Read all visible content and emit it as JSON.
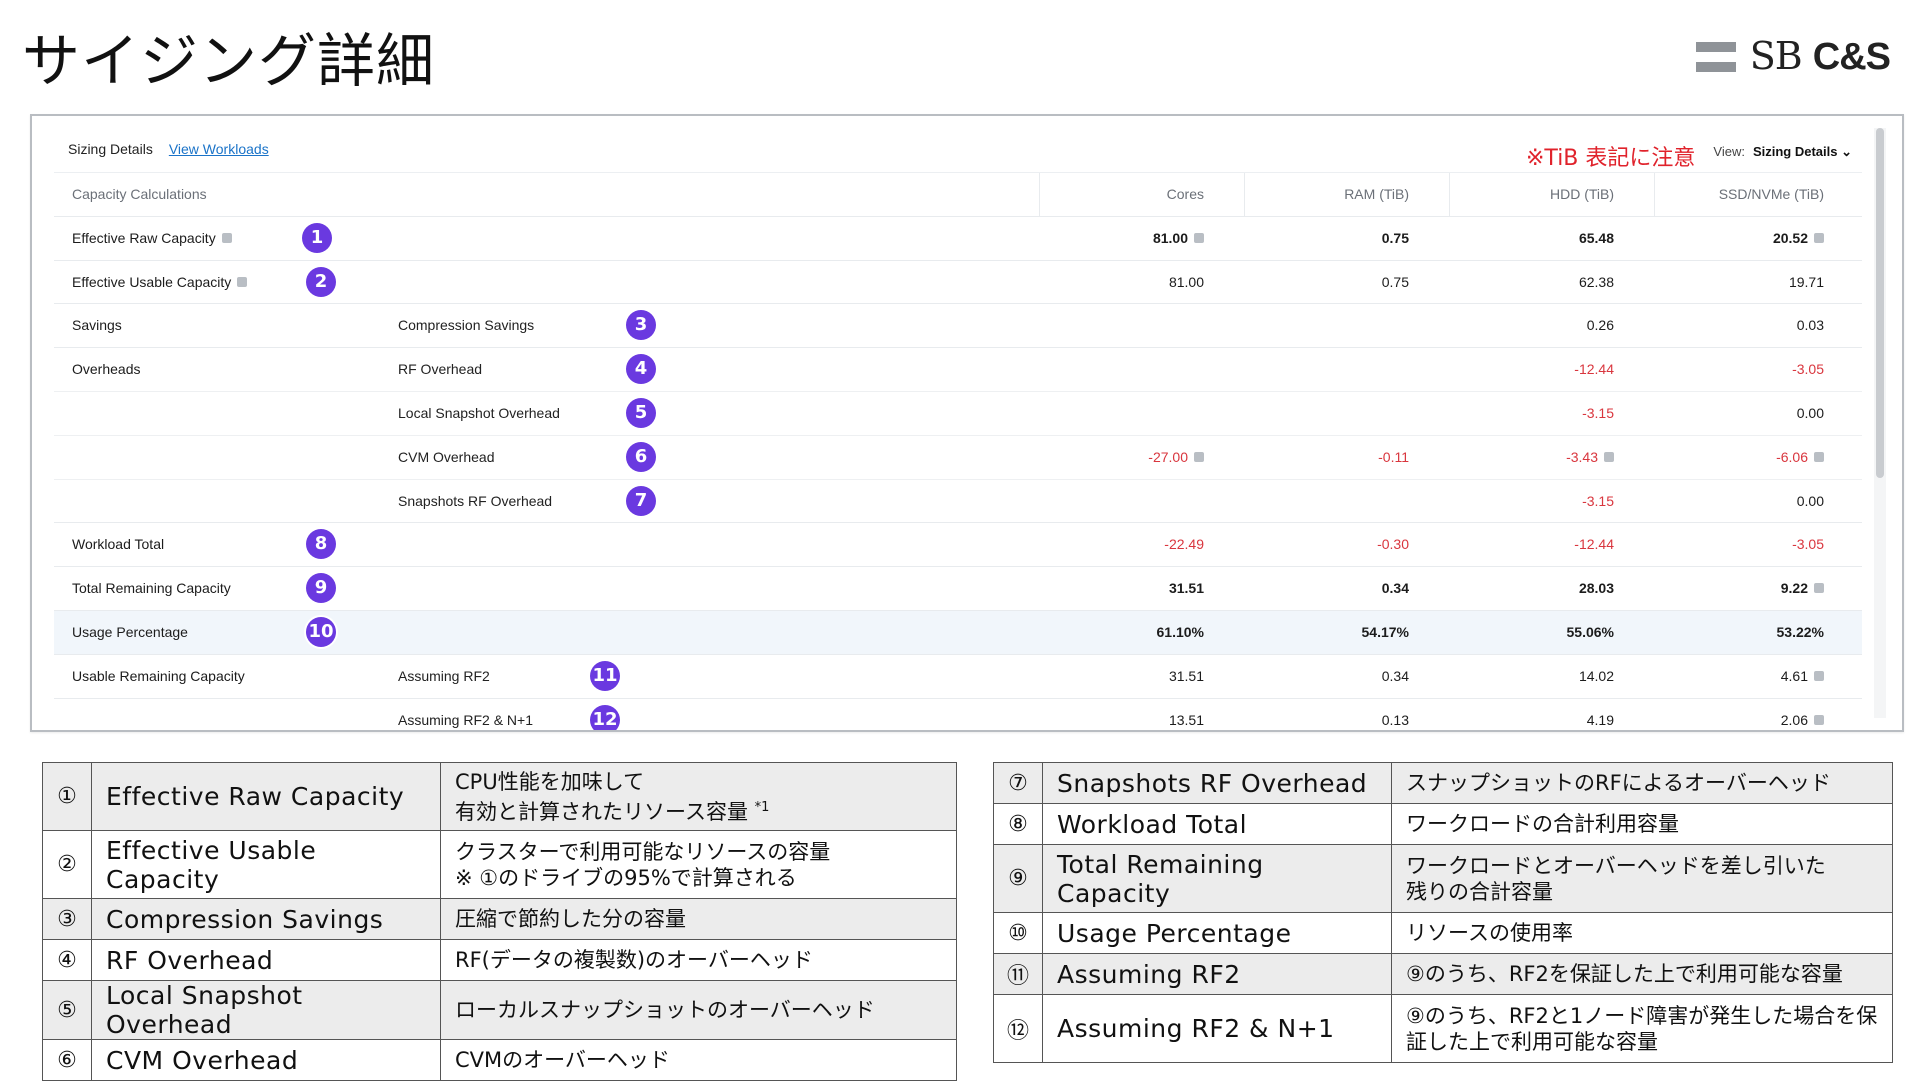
{
  "slide": {
    "title": "サイジング詳細",
    "logo_text_a": "SB",
    "logo_text_b": "C&S"
  },
  "panel": {
    "header": {
      "title": "Sizing Details",
      "link": "View Workloads",
      "note": "※TiB 表記に注意",
      "view_label": "View:",
      "view_value": "Sizing Details ⌄"
    },
    "columns": {
      "section": "Capacity Calculations",
      "cores": "Cores",
      "ram": "RAM (TiB)",
      "hdd": "HDD (TiB)",
      "ssd": "SSD/NVMe (TiB)"
    },
    "rows": [
      {
        "label": "Effective Raw Capacity",
        "sub": "",
        "badge": "1",
        "cores": "81.00",
        "ram": "0.75",
        "hdd": "65.48",
        "ssd": "20.52"
      },
      {
        "label": "Effective Usable Capacity",
        "sub": "",
        "badge": "2",
        "cores": "81.00",
        "ram": "0.75",
        "hdd": "62.38",
        "ssd": "19.71"
      },
      {
        "label": "Savings",
        "sub": "Compression Savings",
        "badge": "3",
        "cores": "",
        "ram": "",
        "hdd": "0.26",
        "ssd": "0.03"
      },
      {
        "label": "Overheads",
        "sub": "RF Overhead",
        "badge": "4",
        "cores": "",
        "ram": "",
        "hdd": "-12.44",
        "ssd": "-3.05"
      },
      {
        "label": "",
        "sub": "Local Snapshot Overhead",
        "badge": "5",
        "cores": "",
        "ram": "",
        "hdd": "-3.15",
        "ssd": "0.00"
      },
      {
        "label": "",
        "sub": "CVM Overhead",
        "badge": "6",
        "cores": "-27.00",
        "ram": "-0.11",
        "hdd": "-3.43",
        "ssd": "-6.06"
      },
      {
        "label": "",
        "sub": "Snapshots RF Overhead",
        "badge": "7",
        "cores": "",
        "ram": "",
        "hdd": "-3.15",
        "ssd": "0.00"
      },
      {
        "label": "Workload Total",
        "sub": "",
        "badge": "8",
        "cores": "-22.49",
        "ram": "-0.30",
        "hdd": "-12.44",
        "ssd": "-3.05"
      },
      {
        "label": "Total Remaining Capacity",
        "sub": "",
        "badge": "9",
        "cores": "31.51",
        "ram": "0.34",
        "hdd": "28.03",
        "ssd": "9.22"
      },
      {
        "label": "Usage Percentage",
        "sub": "",
        "badge": "10",
        "cores": "61.10%",
        "ram": "54.17%",
        "hdd": "55.06%",
        "ssd": "53.22%"
      },
      {
        "label": "Usable Remaining Capacity",
        "sub": "Assuming RF2",
        "badge": "11",
        "cores": "31.51",
        "ram": "0.34",
        "hdd": "14.02",
        "ssd": "4.61"
      },
      {
        "label": "",
        "sub": "Assuming RF2 & N+1",
        "badge": "12",
        "cores": "13.51",
        "ram": "0.13",
        "hdd": "4.19",
        "ssd": "2.06"
      }
    ]
  },
  "legend_left": [
    {
      "idx": "①",
      "name": "Effective Raw Capacity",
      "desc1": "CPU性能を加味して",
      "desc2": "有効と計算されたリソース容量",
      "sup": "*1"
    },
    {
      "idx": "②",
      "name": "Effective Usable Capacity",
      "desc1": "クラスターで利用可能なリソースの容量",
      "desc2": "※ ①のドライブの95%で計算される",
      "sup": ""
    },
    {
      "idx": "③",
      "name": "Compression Savings",
      "desc1": "圧縮で節約した分の容量",
      "desc2": "",
      "sup": ""
    },
    {
      "idx": "④",
      "name": "RF Overhead",
      "desc1": "RF(データの複製数)のオーバーヘッド",
      "desc2": "",
      "sup": ""
    },
    {
      "idx": "⑤",
      "name": "Local Snapshot Overhead",
      "desc1": "ローカルスナップショットのオーバーヘッド",
      "desc2": "",
      "sup": ""
    },
    {
      "idx": "⑥",
      "name": "CVM Overhead",
      "desc1": "CVMのオーバーヘッド",
      "desc2": "",
      "sup": ""
    }
  ],
  "legend_right": [
    {
      "idx": "⑦",
      "name": "Snapshots RF Overhead",
      "desc1": "スナップショットのRFによるオーバーヘッド",
      "desc2": ""
    },
    {
      "idx": "⑧",
      "name": "Workload Total",
      "desc1": "ワークロードの合計利用容量",
      "desc2": ""
    },
    {
      "idx": "⑨",
      "name": "Total Remaining Capacity",
      "desc1": "ワークロードとオーバーヘッドを差し引いた",
      "desc2": "残りの合計容量"
    },
    {
      "idx": "⑩",
      "name": "Usage Percentage",
      "desc1": "リソースの使用率",
      "desc2": ""
    },
    {
      "idx": "⑪",
      "name": "Assuming RF2",
      "desc1": "⑨のうち、RF2を保証した上で利用可能な容量",
      "desc2": ""
    },
    {
      "idx": "⑫",
      "name": "Assuming RF2 & N+1",
      "desc1": "⑨のうち、RF2と1ノード障害が発生した場合を保",
      "desc2": "証した上で利用可能な容量"
    }
  ]
}
